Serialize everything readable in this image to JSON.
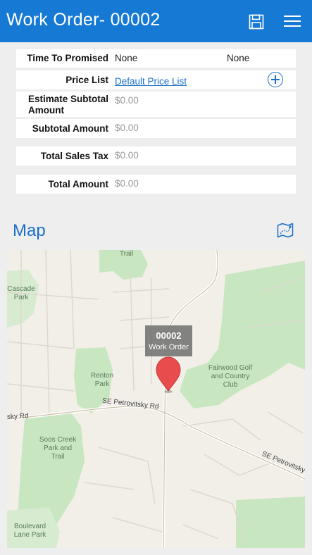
{
  "header": {
    "title": "Work Order- 00002",
    "save_icon": "save-icon",
    "menu_icon": "hamburger-menu-icon"
  },
  "form": {
    "time_to_promised": {
      "label": "Time To Promised",
      "value": "None",
      "value2": "None"
    },
    "price_list": {
      "label": "Price List",
      "value": "Default Price List",
      "add_icon": "plus-circle-icon"
    },
    "estimate_subtotal": {
      "label_line1": "Estimate Subtotal",
      "label_line2": "Amount",
      "value": "$0.00"
    },
    "subtotal": {
      "label": "Subtotal Amount",
      "value": "$0.00"
    },
    "total_sales_tax": {
      "label": "Total Sales Tax",
      "value": "$0.00"
    },
    "total_amount": {
      "label": "Total Amount",
      "value": "$0.00"
    }
  },
  "map_section": {
    "heading": "Map",
    "map_icon": "map-directions-icon",
    "pin": {
      "number": "00002",
      "label": "Work Order"
    },
    "places": {
      "trail_top": "Trail",
      "cascade_park_1": "Cascade",
      "cascade_park_2": "Park",
      "renton_park_1": "Renton",
      "renton_park_2": "Park",
      "fairwood_1": "Fairwood Golf",
      "fairwood_2": "and Country",
      "fairwood_3": "Club",
      "soos_1": "Soos Creek",
      "soos_2": "Park and",
      "soos_3": "Trail",
      "boulevard_1": "Boulevard",
      "boulevard_2": "Lane Park"
    },
    "roads": {
      "sky_rd": "sky Rd",
      "petrovitsky_rd": "SE Petrovitsky Rd",
      "petrovitsky_east": "SE Petrovitsky"
    }
  },
  "colors": {
    "header_bg": "#1679d3",
    "accent": "#1a6fc9",
    "park_green": "#c8e6c0",
    "pin_red": "#e84c4c"
  }
}
